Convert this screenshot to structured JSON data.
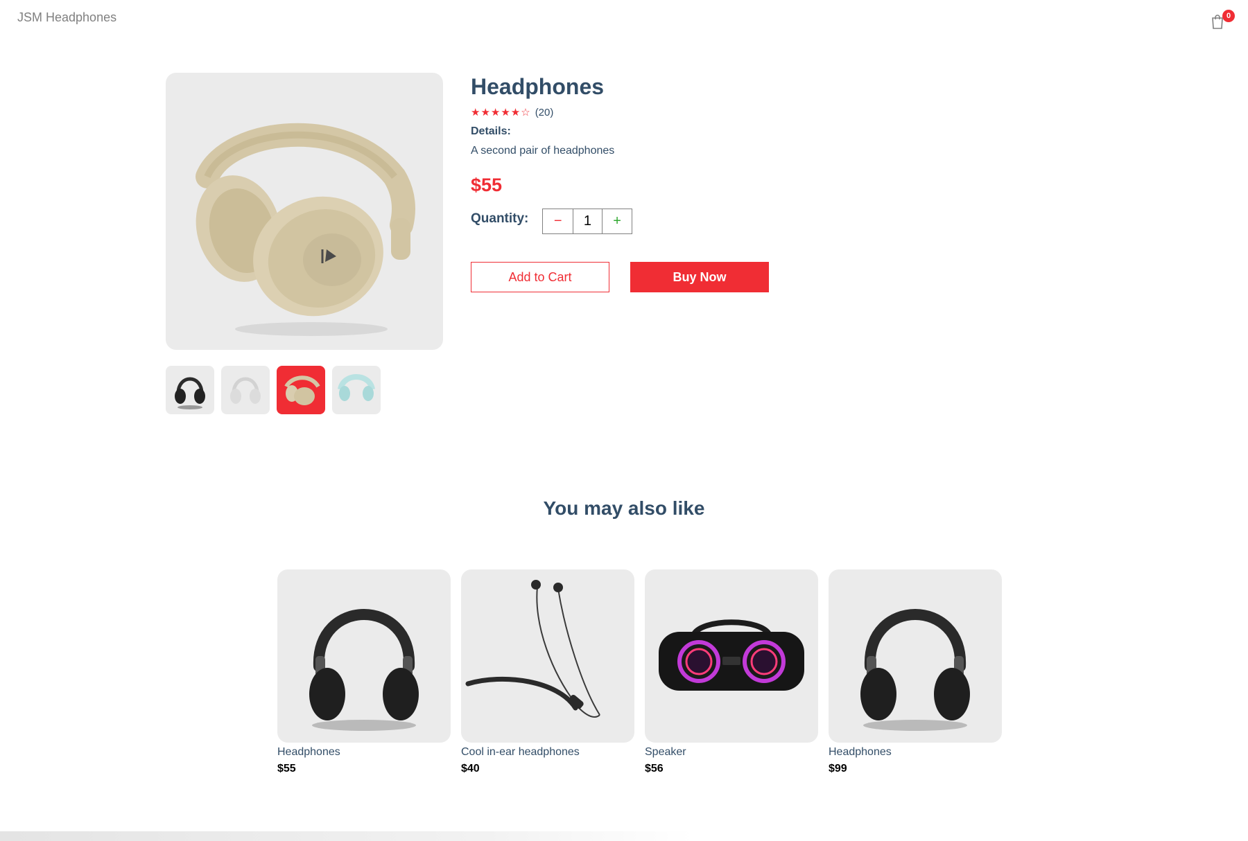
{
  "navbar": {
    "logo": "JSM Headphones",
    "cart_count": "0"
  },
  "product": {
    "title": "Headphones",
    "rating": 4,
    "rating_max": 5,
    "review_count": "(20)",
    "details_label": "Details:",
    "details": "A second pair of headphones",
    "price": "$55",
    "quantity_label": "Quantity:",
    "quantity": "1",
    "minus_symbol": "−",
    "plus_symbol": "+",
    "selected_thumbnail": 3,
    "thumbnails": [
      "black headphones",
      "white headphones",
      "beige headphones",
      "mint headphones"
    ]
  },
  "actions": {
    "add_to_cart": "Add to Cart",
    "buy_now": "Buy Now"
  },
  "also_like": {
    "title": "You may also like",
    "products": [
      {
        "name": "Headphones",
        "price": "$55",
        "image": "black-headphones"
      },
      {
        "name": "Cool in-ear headphones",
        "price": "$40",
        "image": "neckband-earphones"
      },
      {
        "name": "Speaker",
        "price": "$56",
        "image": "speaker"
      },
      {
        "name": "Headphones",
        "price": "$99",
        "image": "black-headphones"
      }
    ]
  },
  "colors": {
    "accent": "#f02d34",
    "text": "#324d67",
    "image_bg": "#ebebeb",
    "plus": "#31a831"
  }
}
